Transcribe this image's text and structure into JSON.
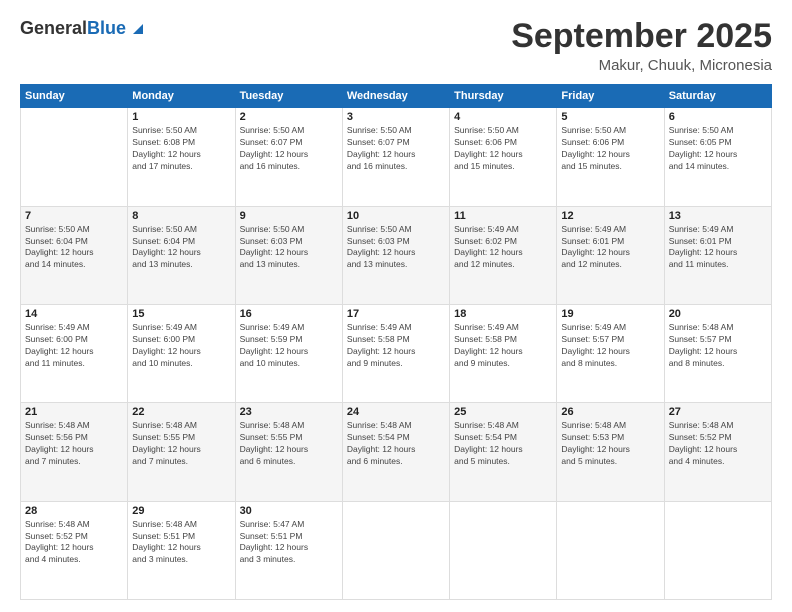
{
  "header": {
    "logo_general": "General",
    "logo_blue": "Blue",
    "month": "September 2025",
    "location": "Makur, Chuuk, Micronesia"
  },
  "weekdays": [
    "Sunday",
    "Monday",
    "Tuesday",
    "Wednesday",
    "Thursday",
    "Friday",
    "Saturday"
  ],
  "weeks": [
    [
      {
        "day": "",
        "info": ""
      },
      {
        "day": "1",
        "info": "Sunrise: 5:50 AM\nSunset: 6:08 PM\nDaylight: 12 hours\nand 17 minutes."
      },
      {
        "day": "2",
        "info": "Sunrise: 5:50 AM\nSunset: 6:07 PM\nDaylight: 12 hours\nand 16 minutes."
      },
      {
        "day": "3",
        "info": "Sunrise: 5:50 AM\nSunset: 6:07 PM\nDaylight: 12 hours\nand 16 minutes."
      },
      {
        "day": "4",
        "info": "Sunrise: 5:50 AM\nSunset: 6:06 PM\nDaylight: 12 hours\nand 15 minutes."
      },
      {
        "day": "5",
        "info": "Sunrise: 5:50 AM\nSunset: 6:06 PM\nDaylight: 12 hours\nand 15 minutes."
      },
      {
        "day": "6",
        "info": "Sunrise: 5:50 AM\nSunset: 6:05 PM\nDaylight: 12 hours\nand 14 minutes."
      }
    ],
    [
      {
        "day": "7",
        "info": "Sunrise: 5:50 AM\nSunset: 6:04 PM\nDaylight: 12 hours\nand 14 minutes."
      },
      {
        "day": "8",
        "info": "Sunrise: 5:50 AM\nSunset: 6:04 PM\nDaylight: 12 hours\nand 13 minutes."
      },
      {
        "day": "9",
        "info": "Sunrise: 5:50 AM\nSunset: 6:03 PM\nDaylight: 12 hours\nand 13 minutes."
      },
      {
        "day": "10",
        "info": "Sunrise: 5:50 AM\nSunset: 6:03 PM\nDaylight: 12 hours\nand 13 minutes."
      },
      {
        "day": "11",
        "info": "Sunrise: 5:49 AM\nSunset: 6:02 PM\nDaylight: 12 hours\nand 12 minutes."
      },
      {
        "day": "12",
        "info": "Sunrise: 5:49 AM\nSunset: 6:01 PM\nDaylight: 12 hours\nand 12 minutes."
      },
      {
        "day": "13",
        "info": "Sunrise: 5:49 AM\nSunset: 6:01 PM\nDaylight: 12 hours\nand 11 minutes."
      }
    ],
    [
      {
        "day": "14",
        "info": "Sunrise: 5:49 AM\nSunset: 6:00 PM\nDaylight: 12 hours\nand 11 minutes."
      },
      {
        "day": "15",
        "info": "Sunrise: 5:49 AM\nSunset: 6:00 PM\nDaylight: 12 hours\nand 10 minutes."
      },
      {
        "day": "16",
        "info": "Sunrise: 5:49 AM\nSunset: 5:59 PM\nDaylight: 12 hours\nand 10 minutes."
      },
      {
        "day": "17",
        "info": "Sunrise: 5:49 AM\nSunset: 5:58 PM\nDaylight: 12 hours\nand 9 minutes."
      },
      {
        "day": "18",
        "info": "Sunrise: 5:49 AM\nSunset: 5:58 PM\nDaylight: 12 hours\nand 9 minutes."
      },
      {
        "day": "19",
        "info": "Sunrise: 5:49 AM\nSunset: 5:57 PM\nDaylight: 12 hours\nand 8 minutes."
      },
      {
        "day": "20",
        "info": "Sunrise: 5:48 AM\nSunset: 5:57 PM\nDaylight: 12 hours\nand 8 minutes."
      }
    ],
    [
      {
        "day": "21",
        "info": "Sunrise: 5:48 AM\nSunset: 5:56 PM\nDaylight: 12 hours\nand 7 minutes."
      },
      {
        "day": "22",
        "info": "Sunrise: 5:48 AM\nSunset: 5:55 PM\nDaylight: 12 hours\nand 7 minutes."
      },
      {
        "day": "23",
        "info": "Sunrise: 5:48 AM\nSunset: 5:55 PM\nDaylight: 12 hours\nand 6 minutes."
      },
      {
        "day": "24",
        "info": "Sunrise: 5:48 AM\nSunset: 5:54 PM\nDaylight: 12 hours\nand 6 minutes."
      },
      {
        "day": "25",
        "info": "Sunrise: 5:48 AM\nSunset: 5:54 PM\nDaylight: 12 hours\nand 5 minutes."
      },
      {
        "day": "26",
        "info": "Sunrise: 5:48 AM\nSunset: 5:53 PM\nDaylight: 12 hours\nand 5 minutes."
      },
      {
        "day": "27",
        "info": "Sunrise: 5:48 AM\nSunset: 5:52 PM\nDaylight: 12 hours\nand 4 minutes."
      }
    ],
    [
      {
        "day": "28",
        "info": "Sunrise: 5:48 AM\nSunset: 5:52 PM\nDaylight: 12 hours\nand 4 minutes."
      },
      {
        "day": "29",
        "info": "Sunrise: 5:48 AM\nSunset: 5:51 PM\nDaylight: 12 hours\nand 3 minutes."
      },
      {
        "day": "30",
        "info": "Sunrise: 5:47 AM\nSunset: 5:51 PM\nDaylight: 12 hours\nand 3 minutes."
      },
      {
        "day": "",
        "info": ""
      },
      {
        "day": "",
        "info": ""
      },
      {
        "day": "",
        "info": ""
      },
      {
        "day": "",
        "info": ""
      }
    ]
  ]
}
